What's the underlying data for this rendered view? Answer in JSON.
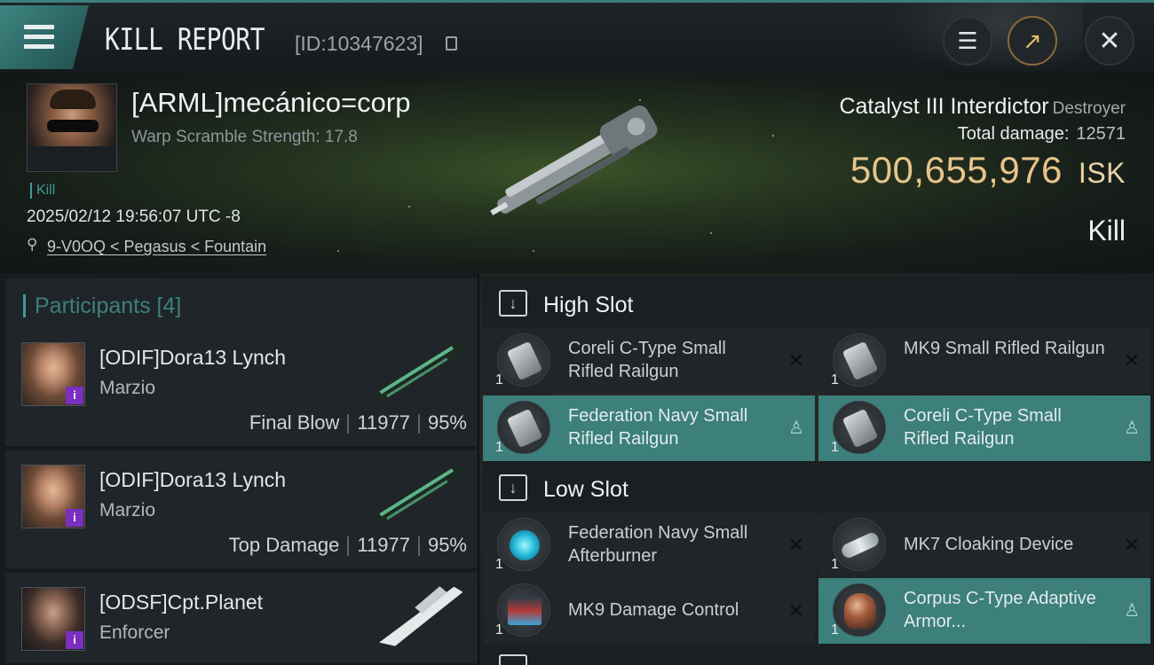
{
  "header": {
    "title": "KILL REPORT",
    "report_id": "[ID:10347623]"
  },
  "victim": {
    "name": "[ARML]mecánico=corp",
    "subtitle": "Warp Scramble Strength: 17.8",
    "tag": "Kill",
    "timestamp": "2025/02/12 19:56:07 UTC -8",
    "location": "9-V0OQ < Pegasus < Fountain"
  },
  "ship": {
    "name": "Catalyst III Interdictor",
    "class": "Destroyer",
    "total_damage_label": "Total damage:",
    "total_damage": "12571",
    "isk_value": "500,655,976",
    "isk_unit": "ISK",
    "result": "Kill"
  },
  "participants": {
    "label": "Participants [4]",
    "rows": [
      {
        "name": "[ODIF]Dora13 Lynch",
        "ship": "Marzio",
        "role": "Final Blow",
        "damage": "11977",
        "pct": "95%",
        "portrait": "f"
      },
      {
        "name": "[ODIF]Dora13 Lynch",
        "ship": "Marzio",
        "role": "Top Damage",
        "damage": "11977",
        "pct": "95%",
        "portrait": "f"
      },
      {
        "name": "[ODSF]Cpt.Planet",
        "ship": "Enforcer",
        "role": "",
        "damage": "",
        "pct": "",
        "portrait": "m"
      }
    ]
  },
  "fittings": {
    "high_slot_label": "High Slot",
    "low_slot_label": "Low Slot",
    "high": [
      {
        "name": "Coreli C-Type Small Rifled Railgun",
        "qty": "1",
        "status": "destroyed",
        "icon": "railgun-icon"
      },
      {
        "name": "MK9 Small Rifled Railgun",
        "qty": "1",
        "status": "destroyed",
        "icon": "railgun-icon"
      },
      {
        "name": "Federation Navy Small Rifled Railgun",
        "qty": "1",
        "status": "dropped",
        "icon": "railgun-icon"
      },
      {
        "name": "Coreli C-Type Small Rifled Railgun",
        "qty": "1",
        "status": "dropped",
        "icon": "railgun-icon"
      }
    ],
    "low": [
      {
        "name": "Federation Navy Small Afterburner",
        "qty": "1",
        "status": "destroyed",
        "icon": "afterburner-icon"
      },
      {
        "name": "MK7 Cloaking Device",
        "qty": "1",
        "status": "destroyed",
        "icon": "cloak-icon"
      },
      {
        "name": "MK9 Damage Control",
        "qty": "1",
        "status": "destroyed",
        "icon": "damage-control-icon"
      },
      {
        "name": "Corpus C-Type Adaptive Armor...",
        "qty": "1",
        "status": "dropped",
        "icon": "armor-icon"
      }
    ]
  },
  "colors": {
    "accent": "#3c7f7b",
    "isk": "#e7c48a",
    "implant_badge": "#7b2fbe"
  }
}
